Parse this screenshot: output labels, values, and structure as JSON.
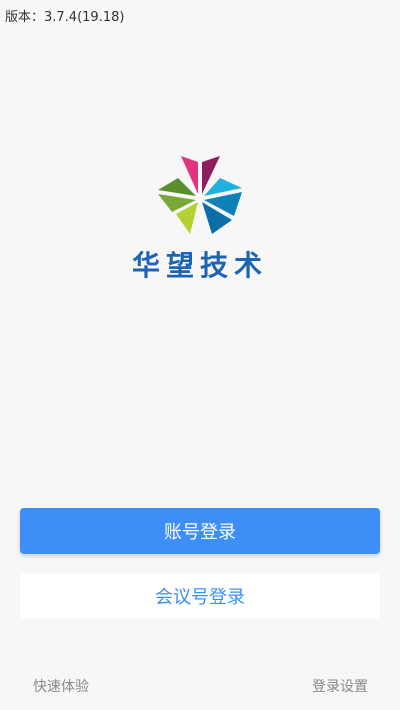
{
  "header": {
    "version": "版本：3.7.4(19.18)"
  },
  "brand": {
    "name": "华望技术",
    "logo_icon": "flower-logo-icon",
    "logo_colors": [
      "#e0357e",
      "#8e1e5e",
      "#20b0de",
      "#0f80b8",
      "#b5d130",
      "#7aa838"
    ]
  },
  "actions": {
    "account_login": "账号登录",
    "meeting_login": "会议号登录"
  },
  "footer": {
    "quick_experience": "快速体验",
    "login_settings": "登录设置"
  },
  "colors": {
    "primary": "#3d8ef7",
    "brand_text": "#1e64b4",
    "background": "#f7f7f7"
  }
}
